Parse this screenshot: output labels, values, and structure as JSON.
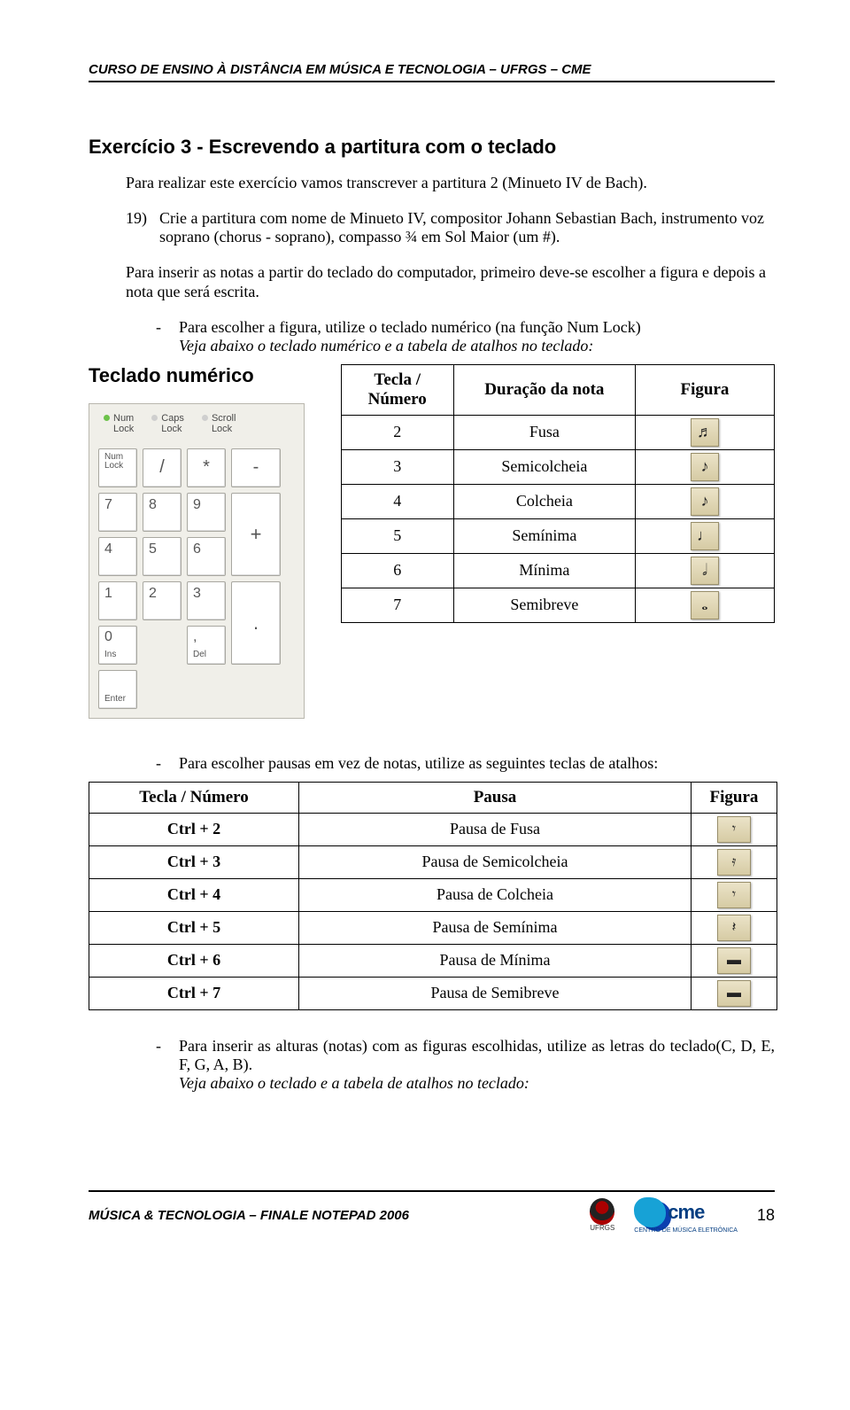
{
  "header": "CURSO DE ENSINO À DISTÂNCIA EM MÚSICA E TECNOLOGIA – UFRGS – CME",
  "title": "Exercício 3 - Escrevendo a partitura com o teclado",
  "intro": "Para realizar este exercício vamos transcrever a partitura 2 (Minueto IV de Bach).",
  "step19_num": "19)",
  "step19": "Crie a partitura com nome de Minueto IV, compositor Johann Sebastian Bach, instrumento voz soprano (chorus - soprano), compasso ¾ em Sol Maior (um #).",
  "para2": "Para inserir as notas a partir do teclado do computador, primeiro deve-se escolher a figura e depois a nota que será escrita.",
  "dash1_a": "Para escolher a figura, utilize o teclado numérico (na função Num Lock)",
  "dash1_b": "Veja abaixo o teclado numérico e a tabela de atalhos no teclado:",
  "keypad_title": "Teclado numérico",
  "locks": {
    "num": "Num\nLock",
    "caps": "Caps\nLock",
    "scroll": "Scroll\nLock"
  },
  "keys": {
    "numlock": "Num\nLock",
    "slash": "/",
    "star": "*",
    "minus": "-",
    "k7": "7",
    "k8": "8",
    "k9": "9",
    "plus": "+",
    "k4": "4",
    "k5": "5",
    "k6": "6",
    "dot": ".",
    "k1": "1",
    "k2": "2",
    "k3": "3",
    "enter": "Enter",
    "k0": "0",
    "ins": "Ins",
    "comma": ",",
    "del": "Del"
  },
  "table1": {
    "h1": "Tecla / Número",
    "h2": "Duração da nota",
    "h3": "Figura",
    "rows": [
      {
        "k": "2",
        "d": "Fusa",
        "g": "♬"
      },
      {
        "k": "3",
        "d": "Semicolcheia",
        "g": "♪"
      },
      {
        "k": "4",
        "d": "Colcheia",
        "g": "♪"
      },
      {
        "k": "5",
        "d": "Semínima",
        "g": "♩"
      },
      {
        "k": "6",
        "d": "Mínima",
        "g": "𝅗𝅥"
      },
      {
        "k": "7",
        "d": "Semibreve",
        "g": "𝅝"
      }
    ]
  },
  "dash2": "Para escolher pausas em vez de notas, utilize as seguintes teclas de atalhos:",
  "table2": {
    "h1": "Tecla / Número",
    "h2": "Pausa",
    "h3": "Figura",
    "rows": [
      {
        "k": "Ctrl + 2",
        "d": "Pausa de Fusa",
        "g": "𝄾"
      },
      {
        "k": "Ctrl + 3",
        "d": "Pausa de Semicolcheia",
        "g": "𝄿"
      },
      {
        "k": "Ctrl + 4",
        "d": "Pausa de Colcheia",
        "g": "𝄾"
      },
      {
        "k": "Ctrl + 5",
        "d": "Pausa de Semínima",
        "g": "𝄽"
      },
      {
        "k": "Ctrl + 6",
        "d": "Pausa de Mínima",
        "g": "▬"
      },
      {
        "k": "Ctrl + 7",
        "d": "Pausa de Semibreve",
        "g": "▬"
      }
    ]
  },
  "dash3_a": "Para inserir as alturas (notas) com as figuras escolhidas, utilize as letras do teclado(C, D, E, F, G, A, B).",
  "dash3_b": "Veja abaixo o teclado e a tabela de atalhos no teclado:",
  "footer_left": "MÚSICA & TECNOLOGIA – FINALE NOTEPAD 2006",
  "footer_logo": "UFRGS",
  "cme_text": "cme",
  "cme_sub": "CENTRO DE MÚSICA ELETRÔNICA",
  "page_num": "18"
}
